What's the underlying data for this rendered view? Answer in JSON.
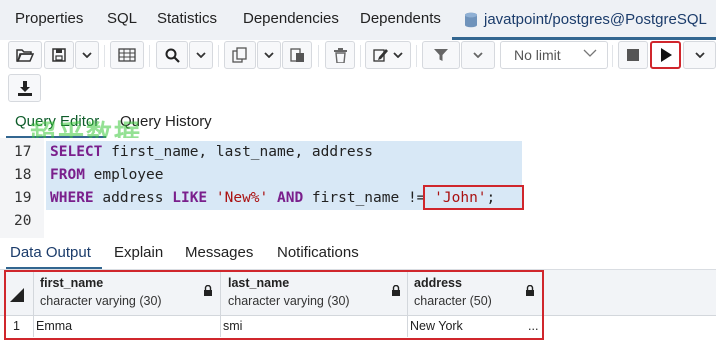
{
  "top_tabs": [
    "Properties",
    "SQL",
    "Statistics",
    "Dependencies",
    "Dependents"
  ],
  "active_tab": "javatpoint/postgres@PostgreSQL",
  "toolbar": {
    "limit_value": "No limit"
  },
  "editor_tabs": [
    "Query Editor",
    "Query History"
  ],
  "watermark": "超乎数据",
  "code": {
    "line_numbers": [
      "17",
      "18",
      "19",
      "20"
    ],
    "line17": {
      "kw1": "SELECT",
      "rest": " first_name, last_name, address"
    },
    "line18": {
      "kw1": "FROM",
      "rest": " employee"
    },
    "line19": {
      "kw1": "WHERE",
      "part1": " address ",
      "kw2": "LIKE",
      "str1": " 'New%'",
      "kw3": " AND",
      "part2": " first_name ",
      "op": "!= ",
      "str2": "'John'",
      "end": ";"
    }
  },
  "output_tabs": [
    "Data Output",
    "Explain",
    "Messages",
    "Notifications"
  ],
  "grid": {
    "columns": [
      {
        "name": "first_name",
        "type": "character varying (30)"
      },
      {
        "name": "last_name",
        "type": "character varying (30)"
      },
      {
        "name": "address",
        "type": "character (50)"
      }
    ],
    "rows": [
      {
        "num": "1",
        "cells": [
          "Emma",
          "smi",
          "New York"
        ],
        "more": "..."
      }
    ]
  },
  "colors": {
    "accent": "#326690",
    "highlight_box": "#d0262c",
    "keyword": "#7a1f8c",
    "string": "#aa1111"
  }
}
